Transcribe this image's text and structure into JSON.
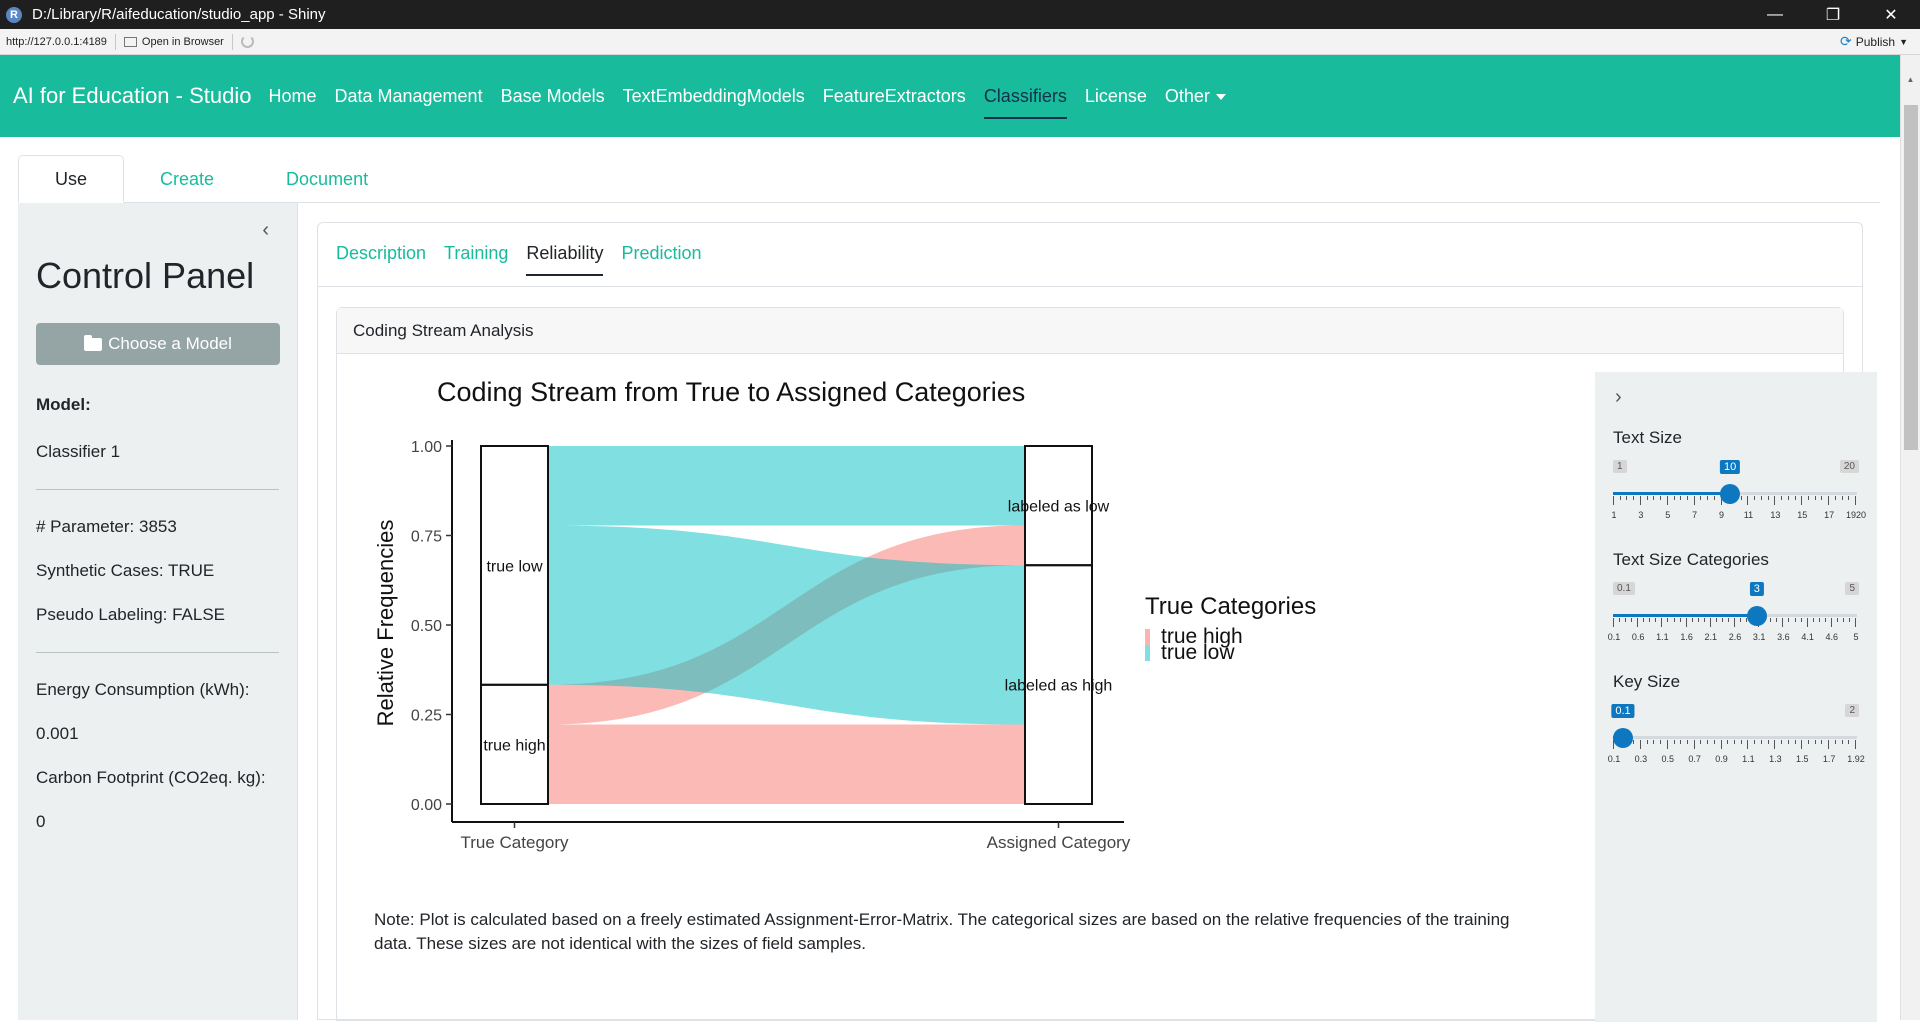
{
  "window": {
    "title": "D:/Library/R/aifeducation/studio_app - Shiny",
    "url": "http://127.0.0.1:4189",
    "open_in_browser": "Open in Browser",
    "publish": "Publish"
  },
  "navbar": {
    "brand": "AI for Education - Studio",
    "items": [
      {
        "label": "Home"
      },
      {
        "label": "Data Management"
      },
      {
        "label": "Base Models"
      },
      {
        "label": "TextEmbeddingModels"
      },
      {
        "label": "FeatureExtractors"
      },
      {
        "label": "Classifiers"
      },
      {
        "label": "License"
      },
      {
        "label": "Other"
      }
    ],
    "active": "Classifiers"
  },
  "top_tabs": [
    {
      "label": "Use"
    },
    {
      "label": "Create"
    },
    {
      "label": "Document"
    }
  ],
  "sidebar": {
    "title": "Control Panel",
    "choose_model": "Choose a Model",
    "model_label": "Model:",
    "model_value": "Classifier 1",
    "parameter": "# Parameter: 3853",
    "synthetic_cases": "Synthetic Cases: TRUE",
    "pseudo_labeling": "Pseudo Labeling: FALSE",
    "energy_label": "Energy Consumption (kWh):",
    "energy_value": "0.001",
    "carbon_label": "Carbon Footprint (CO2eq. kg):",
    "carbon_value": "0"
  },
  "inner_tabs": [
    {
      "label": "Description"
    },
    {
      "label": "Training"
    },
    {
      "label": "Reliability"
    },
    {
      "label": "Prediction"
    }
  ],
  "card": {
    "header": "Coding Stream Analysis",
    "note": "Note: Plot is calculated based on a freely estimated Assignment-Error-Matrix. The categorical sizes are based on the relative frequencies of the training data. These sizes are not identical with the sizes of field samples."
  },
  "chart_data": {
    "type": "alluvial",
    "title": "Coding Stream from True to Assigned Categories",
    "ylabel": "Relative Frequencies",
    "xlabel": "",
    "x": [
      "True Category",
      "Assigned Category"
    ],
    "yticks": [
      "0.00",
      "0.25",
      "0.50",
      "0.75",
      "1.00"
    ],
    "ylim": [
      0,
      1
    ],
    "legend_title": "True Categories",
    "legend_position": "right",
    "true_strata": [
      {
        "label": "true high",
        "from": 0.0,
        "to": 0.333
      },
      {
        "label": "true low",
        "from": 0.333,
        "to": 1.0
      }
    ],
    "assigned_strata": [
      {
        "label": "labeled as high",
        "from": 0.0,
        "to": 0.667
      },
      {
        "label": "labeled as low",
        "from": 0.667,
        "to": 1.0
      }
    ],
    "flows": [
      {
        "source": "true high",
        "target": "labeled as high",
        "value": 0.222,
        "color": "#f8766d"
      },
      {
        "source": "true high",
        "target": "labeled as low",
        "value": 0.111,
        "color": "#f8766d"
      },
      {
        "source": "true low",
        "target": "labeled as high",
        "value": 0.445,
        "color": "#00bfc4"
      },
      {
        "source": "true low",
        "target": "labeled as low",
        "value": 0.222,
        "color": "#00bfc4"
      }
    ],
    "series": [
      {
        "name": "true high",
        "color": "#f8766d"
      },
      {
        "name": "true low",
        "color": "#00bfc4"
      }
    ]
  },
  "settings": {
    "sliders": [
      {
        "label": "Text Size",
        "min": "1",
        "max": "20",
        "value": "10",
        "fraction": 0.474,
        "ticks": [
          "1",
          "3",
          "5",
          "7",
          "9",
          "11",
          "13",
          "15",
          "17",
          "1920"
        ]
      },
      {
        "label": "Text Size Categories",
        "min": "0.1",
        "max": "5",
        "value": "3",
        "fraction": 0.592,
        "ticks": [
          "0.1",
          "0.6",
          "1.1",
          "1.6",
          "2.1",
          "2.6",
          "3.1",
          "3.6",
          "4.1",
          "4.6",
          "5"
        ]
      },
      {
        "label": "Key Size",
        "min": "0.1",
        "max": "2",
        "value": "0.1",
        "fraction": 0.0,
        "ticks": [
          "0.1",
          "0.3",
          "0.5",
          "0.7",
          "0.9",
          "1.1",
          "1.3",
          "1.5",
          "1.7",
          "1.92"
        ]
      }
    ]
  }
}
